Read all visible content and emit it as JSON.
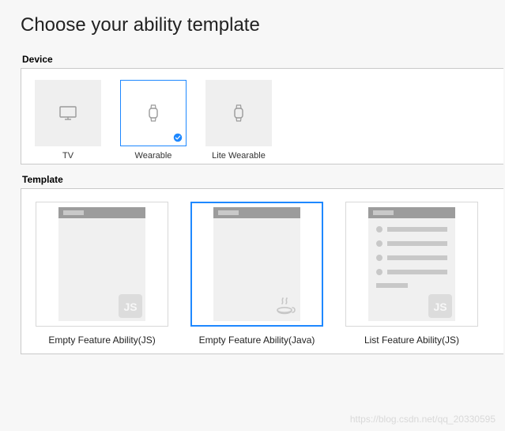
{
  "title": "Choose your ability template",
  "sections": {
    "device_label": "Device",
    "template_label": "Template"
  },
  "devices": [
    {
      "id": "tv",
      "label": "TV",
      "icon": "tv-icon",
      "selected": false
    },
    {
      "id": "wearable",
      "label": "Wearable",
      "icon": "watch-icon",
      "selected": true
    },
    {
      "id": "lite-wearable",
      "label": "Lite Wearable",
      "icon": "watch-icon",
      "selected": false
    }
  ],
  "templates": [
    {
      "id": "empty-js",
      "label": "Empty Feature Ability(JS)",
      "badge": "js",
      "layout": "empty",
      "selected": false
    },
    {
      "id": "empty-java",
      "label": "Empty Feature Ability(Java)",
      "badge": "java",
      "layout": "empty",
      "selected": true
    },
    {
      "id": "list-js",
      "label": "List Feature Ability(JS)",
      "badge": "js",
      "layout": "list",
      "selected": false
    }
  ],
  "watermark": "https://blog.csdn.net/qq_20330595"
}
